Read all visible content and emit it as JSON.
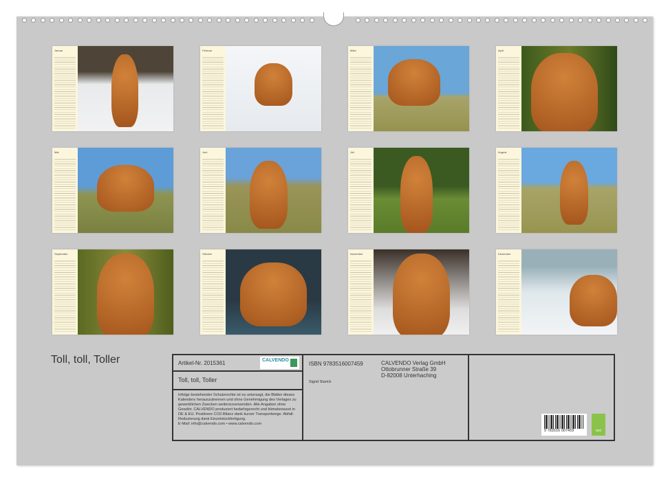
{
  "title": "Toll, toll, Toller",
  "months": [
    "Januar",
    "Februar",
    "März",
    "April",
    "Mai",
    "Juni",
    "Juli",
    "August",
    "September",
    "Oktober",
    "November",
    "Dezember"
  ],
  "info": {
    "article": "Artikel-Nr. 2015361",
    "logo": "CALVENDO",
    "product_title": "Toll, toll, Toller",
    "legal": "Infolge bestehender Schutzrechte ist es untersagt, die Blätter dieses Kalenders herauszutrennen und ohne Genehmigung des Verlages zu gewerblichen Zwecken weiterzuverwenden. Alle Angaben ohne Gewähr. CALVENDO produziert bedarfsgerecht und klimabewusst in DE & EU. Positivere CO2-Bilanz dank kurzer Transportwege. Abfall-Reduzierung dank Einzelstückfertigung.",
    "contact": "E-Mail: info@calvendo.com • www.calvendo.com",
    "isbn": "ISBN 9783516007459",
    "author": "Sigrid Starick",
    "publisher": [
      "CALVENDO Verlag GmbH",
      "Ottobrunner Straße 39",
      "D-82008 Unterhaching"
    ],
    "barcode_number": "9 783516 007459",
    "eco_label": "eco"
  }
}
